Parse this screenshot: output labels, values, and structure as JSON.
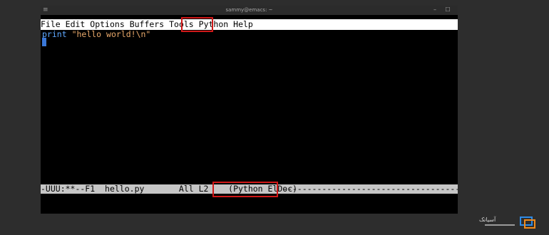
{
  "window": {
    "title": "sammy@emacs: ~",
    "menu_glyph": "≡",
    "minimize": "–",
    "maximize": "☐"
  },
  "menubar": {
    "items": [
      "File",
      "Edit",
      "Options",
      "Buffers",
      "Tools",
      "Python",
      "Help"
    ],
    "highlighted": "Python"
  },
  "buffer": {
    "keyword": "print",
    "string": "\"hello world!\\n\""
  },
  "modeline": {
    "status": "-UUU:**--F1",
    "filename": "hello.py",
    "position": "All L2",
    "modes": "(Python ElDoc)",
    "dashes": "--------------------------------------------------"
  },
  "watermark": {
    "text": "آسیاتک"
  },
  "colors": {
    "highlight_box": "#d01818",
    "keyword": "#5fa8ff",
    "string": "#e8a86a",
    "cursor": "#3a78d8"
  }
}
